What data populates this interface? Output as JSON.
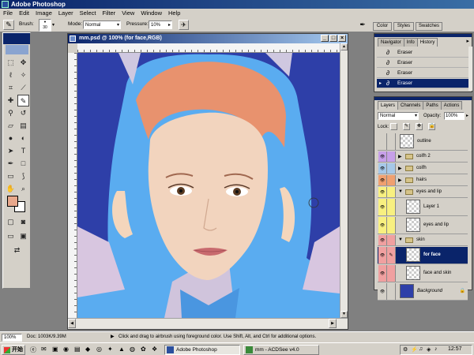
{
  "app": {
    "title": "Adobe Photoshop"
  },
  "menu": [
    "File",
    "Edit",
    "Image",
    "Layer",
    "Select",
    "Filter",
    "View",
    "Window",
    "Help"
  ],
  "options_bar": {
    "brush_label": "Brush:",
    "brush_size": "30",
    "mode_label": "Mode:",
    "mode_value": "Normal",
    "pressure_label": "Pressure:",
    "pressure_value": "10%"
  },
  "palette_tabs": [
    "Color",
    "Styles",
    "Swatches"
  ],
  "document": {
    "title": "mm.psd @ 100% (for face,RGB)"
  },
  "navigator_panel": {
    "tabs": [
      "Navigator",
      "Info",
      "History"
    ],
    "history_items": [
      "Eraser",
      "Eraser",
      "Eraser",
      "Eraser"
    ],
    "selected_index": 3
  },
  "layers_panel": {
    "tabs": [
      "Layers",
      "Channels",
      "Paths",
      "Actions"
    ],
    "blend_mode": "Normal",
    "opacity_label": "Opacity:",
    "opacity_value": "100%",
    "lock_label": "Lock:",
    "layers": [
      {
        "name": "outline",
        "kind": "layer",
        "color": "#d4d0c8"
      },
      {
        "name": "coifh 2",
        "kind": "set",
        "color": "#c7a0e8"
      },
      {
        "name": "coifh",
        "kind": "set",
        "color": "#a6c8e8"
      },
      {
        "name": "hairs",
        "kind": "set",
        "color": "#f0a070"
      },
      {
        "name": "eyes and lip",
        "kind": "set-open",
        "color": "#f8f080"
      },
      {
        "name": "Layer 1",
        "kind": "layer-in-set",
        "color": "#f8f080"
      },
      {
        "name": "eyes and lip",
        "kind": "layer-in-set",
        "color": "#f8f080"
      },
      {
        "name": "skin",
        "kind": "set-open",
        "color": "#f0a0a0"
      },
      {
        "name": "for face",
        "kind": "layer-in-set-selected",
        "color": "#f0a0a0"
      },
      {
        "name": "face and skin",
        "kind": "layer-in-set",
        "color": "#f0a0a0"
      },
      {
        "name": "Background",
        "kind": "background",
        "color": "#d4d0c8"
      }
    ]
  },
  "status": {
    "zoom": "100%",
    "doc_size": "Doc: 1003K/9.39M",
    "hint": "Click and drag to airbrush using foreground color.  Use Shift, Alt, and Ctrl for additional options."
  },
  "taskbar": {
    "start": "开始",
    "tasks": [
      "Adobe Photoshop",
      "mm - ACDSee v4.0"
    ],
    "clock": "12:57"
  },
  "colors": {
    "foreground": "#e8a88c",
    "background": "#ffffff",
    "canvas_blue": "#2e3fa8",
    "hood_blue": "#5aacf0",
    "hair": "#e8926e",
    "skin": "#f2d4be"
  }
}
